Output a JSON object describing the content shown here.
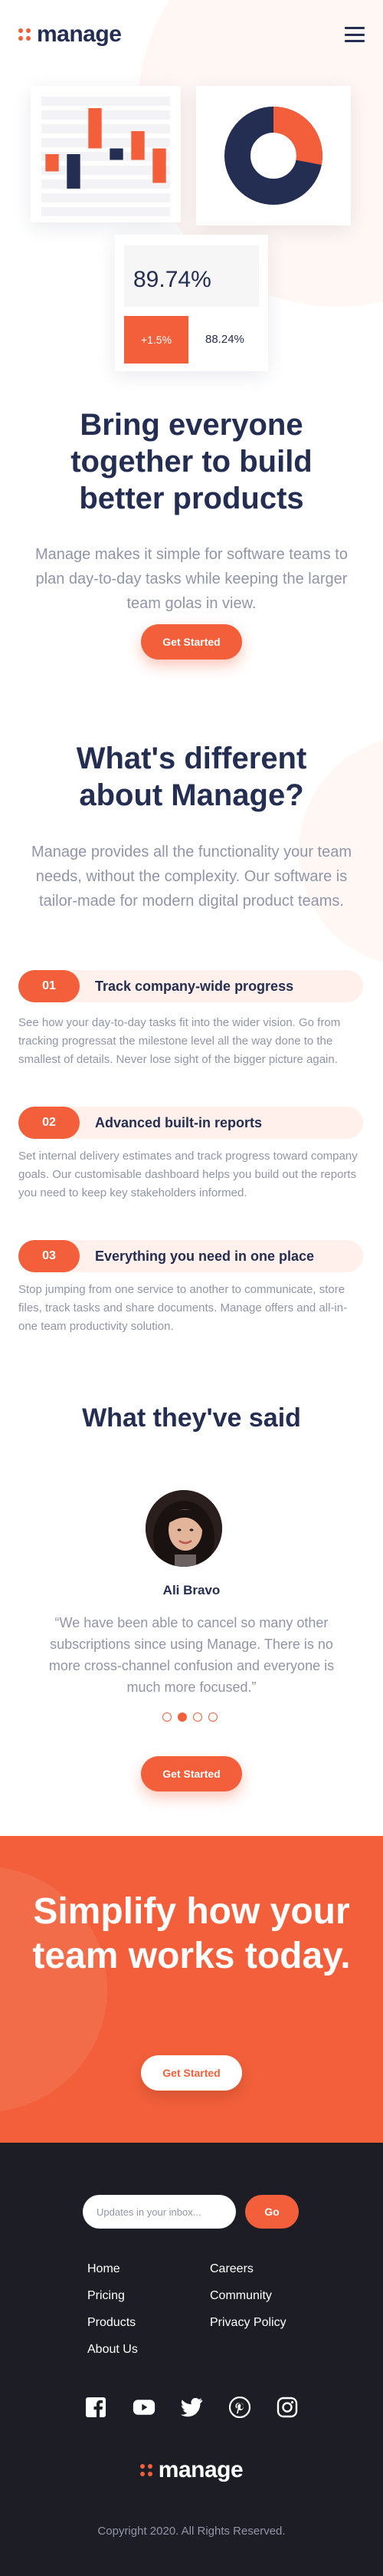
{
  "brand": {
    "name": "manage",
    "accent": "#F25F3A",
    "navy": "#242D52",
    "gray": "#9095A7",
    "footer_bg": "#1D1E25"
  },
  "header": {
    "menu_icon": "hamburger-icon"
  },
  "hero": {
    "stats": {
      "percent": "89.74%",
      "change": "+1.5%",
      "secondary": "88.24%"
    },
    "donut_fill": 0.28,
    "bar_chart": {
      "type": "bar",
      "bars": [
        {
          "color": "#F25F3A",
          "start": 0.5,
          "end": 0.65
        },
        {
          "color": "#242D52",
          "start": 0.5,
          "end": 0.8
        },
        {
          "color": "#F25F3A",
          "start": 0.1,
          "end": 0.45
        },
        {
          "color": "#242D52",
          "start": 0.45,
          "end": 0.55
        },
        {
          "color": "#F25F3A",
          "start": 0.3,
          "end": 0.55
        },
        {
          "color": "#F25F3A",
          "start": 0.45,
          "end": 0.75
        }
      ]
    },
    "title": "Bring everyone together to build better products",
    "subtitle": "Manage makes it simple for software teams to plan day-to-day tasks while keeping the larger team golas in view.",
    "cta": "Get Started"
  },
  "different": {
    "title": "What's different about Manage?",
    "subtitle": "Manage provides all the functionality your team needs, without the complexity. Our software is tailor-made for modern digital product teams.",
    "features": [
      {
        "num": "01",
        "title": "Track company-wide progress",
        "desc": "See how your day-to-day tasks fit into the wider vision. Go from tracking progressat the milestone level all the way done to the smallest of details. Never lose sight of the bigger picture again."
      },
      {
        "num": "02",
        "title": "Advanced built-in reports",
        "desc": "Set internal delivery estimates and track progress toward company goals. Our customisable dashboard helps you build out the reports you need to keep key stakeholders informed."
      },
      {
        "num": "03",
        "title": "Everything you need in one place",
        "desc": "Stop jumping from one service to another to communicate, store files, track tasks and share documents. Manage offers and all-in-one team productivity solution."
      }
    ]
  },
  "testimonials": {
    "title": "What they've said",
    "name": "Ali Bravo",
    "quote": "“We have been able to cancel so many other subscriptions since using Manage. There is no more cross-channel confusion and everyone is much more focused.”",
    "active_dot": 1,
    "cta": "Get Started"
  },
  "cta_band": {
    "title": "Simplify how your team works today.",
    "cta": "Get Started"
  },
  "footer": {
    "newsletter_placeholder": "Updates in your inbox...",
    "go": "Go",
    "links_left": [
      "Home",
      "Pricing",
      "Products",
      "About Us"
    ],
    "links_right": [
      "Careers",
      "Community",
      "Privacy Policy"
    ],
    "social": [
      "facebook-icon",
      "youtube-icon",
      "twitter-icon",
      "pinterest-icon",
      "instagram-icon"
    ],
    "copyright": "Copyright 2020. All Rights Reserved."
  }
}
